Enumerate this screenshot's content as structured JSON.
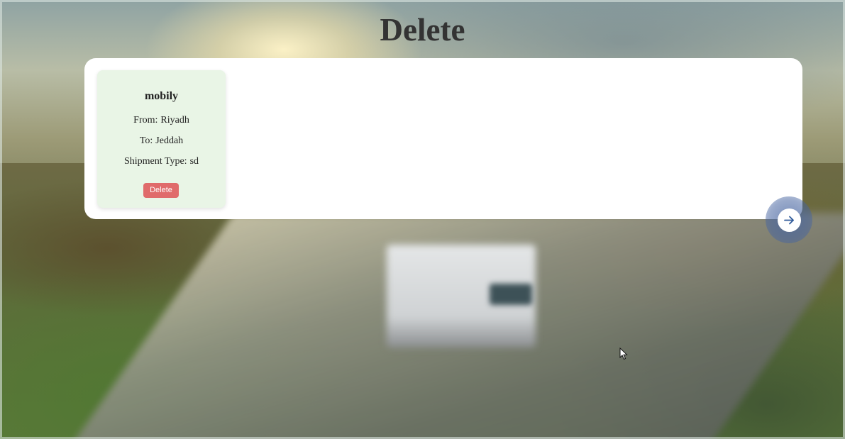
{
  "page": {
    "title": "Delete"
  },
  "shipments": [
    {
      "company": "mobily",
      "from_label": "From:",
      "from_value": "Riyadh",
      "to_label": "To:",
      "to_value": "Jeddah",
      "type_label": "Shipment Type:",
      "type_value": "sd",
      "delete_label": "Delete"
    }
  ],
  "navigation": {
    "next_icon": "arrow-right-icon"
  },
  "colors": {
    "title": "#333333",
    "panel_background": "#ffffff",
    "card_background": "#e9f5e6",
    "delete_button": "#e06b6b",
    "next_halo": "#4664a0",
    "next_arrow": "#2f5a9a"
  },
  "background": {
    "description_icon": "blurred-truck-highway-image"
  }
}
